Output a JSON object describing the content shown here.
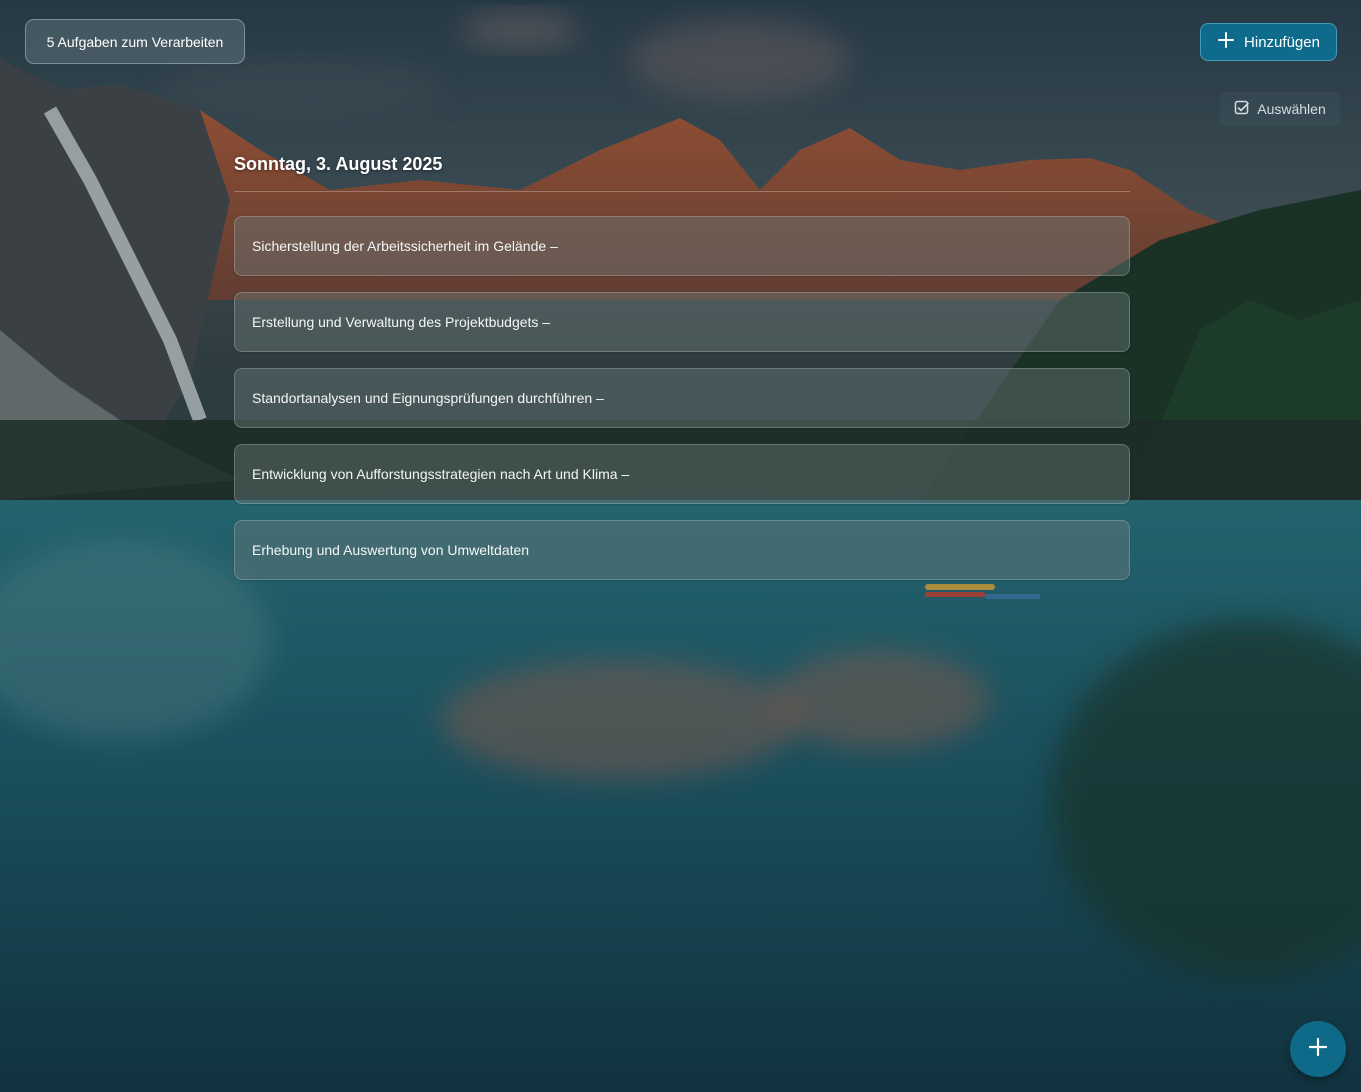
{
  "header": {
    "pending_label": "5 Aufgaben zum Verarbeiten",
    "add_label": "Hinzufügen",
    "select_label": "Auswählen"
  },
  "group": {
    "date": "Sonntag, 3. August 2025",
    "tasks": [
      {
        "title": "Sicherstellung der Arbeitssicherheit im Gelände –"
      },
      {
        "title": "Erstellung und Verwaltung des Projektbudgets –"
      },
      {
        "title": "Standortanalysen und Eignungsprüfungen durchführen –"
      },
      {
        "title": "Entwicklung von Aufforstungsstrategien nach Art und Klima –"
      },
      {
        "title": "Erhebung und Auswertung von Umweltdaten"
      }
    ]
  },
  "icons": {
    "add": "plus-icon",
    "select": "checkbox-icon",
    "fab": "plus-icon"
  },
  "colors": {
    "accent": "#0f6b8c",
    "fab": "#0e6a88"
  }
}
